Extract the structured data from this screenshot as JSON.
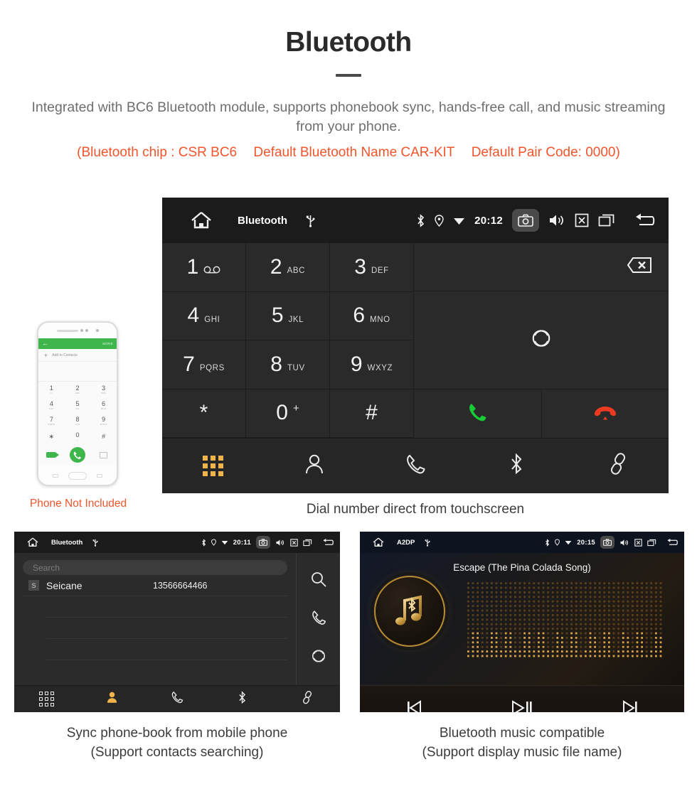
{
  "header": {
    "title": "Bluetooth",
    "description": "Integrated with BC6 Bluetooth module, supports phonebook sync, hands-free call, and music streaming from your phone.",
    "spec_chip": "(Bluetooth chip : CSR BC6",
    "spec_name": "Default Bluetooth Name CAR-KIT",
    "spec_code": "Default Pair Code: 0000)",
    "accent_color": "#f2552c",
    "text_color": "#6f6f6f"
  },
  "main_unit": {
    "statusbar": {
      "home_icon": "home-icon",
      "title": "Bluetooth",
      "usb_icon": "usb-icon",
      "bluetooth_icon": "bluetooth-icon",
      "location_icon": "location-pin-icon",
      "wifi_icon": "wifi-icon",
      "clock": "20:12",
      "camera_icon": "camera-icon",
      "volume_icon": "volume-icon",
      "close_icon": "close-box-icon",
      "recents_icon": "recents-icon",
      "back_icon": "back-arrow-icon"
    },
    "keys": [
      {
        "digit": "1",
        "letters": "",
        "voicemail": true
      },
      {
        "digit": "2",
        "letters": "ABC"
      },
      {
        "digit": "3",
        "letters": "DEF"
      },
      {
        "digit": "4",
        "letters": "GHI"
      },
      {
        "digit": "5",
        "letters": "JKL"
      },
      {
        "digit": "6",
        "letters": "MNO"
      },
      {
        "digit": "7",
        "letters": "PQRS"
      },
      {
        "digit": "8",
        "letters": "TUV"
      },
      {
        "digit": "9",
        "letters": "WXYZ"
      },
      {
        "digit": "*",
        "letters": ""
      },
      {
        "digit": "0",
        "letters": "",
        "plus": "+"
      },
      {
        "digit": "#",
        "letters": ""
      }
    ],
    "actions": {
      "backspace_icon": "backspace-icon",
      "sync_icon": "sync-icon",
      "call_icon": "call-icon",
      "hangup_icon": "hangup-icon",
      "call_color": "#18cc35",
      "hangup_color": "#ee3a21"
    },
    "bottom_nav": [
      {
        "name": "dialpad",
        "icon": "dialpad-icon",
        "active": true
      },
      {
        "name": "contacts",
        "icon": "contacts-icon",
        "active": false
      },
      {
        "name": "call-history",
        "icon": "phone-handset-icon",
        "active": false
      },
      {
        "name": "bluetooth",
        "icon": "bluetooth-icon",
        "active": false
      },
      {
        "name": "pair",
        "icon": "link-icon",
        "active": false
      }
    ],
    "active_color": "#f0b44a",
    "caption": "Dial number direct from touchscreen"
  },
  "phone_mock": {
    "appbar_back": "←",
    "appbar_more": "MORE",
    "add_to_contacts": "Add to Contacts",
    "keys": [
      {
        "d": "1",
        "l": "oo"
      },
      {
        "d": "2",
        "l": "ABC"
      },
      {
        "d": "3",
        "l": "DEF"
      },
      {
        "d": "4",
        "l": "GHI"
      },
      {
        "d": "5",
        "l": "JKL"
      },
      {
        "d": "6",
        "l": "MNO"
      },
      {
        "d": "7",
        "l": "PQRS"
      },
      {
        "d": "8",
        "l": "TUV"
      },
      {
        "d": "9",
        "l": "WXYZ"
      },
      {
        "d": "∗",
        "l": ""
      },
      {
        "d": "0",
        "l": "+"
      },
      {
        "d": "#",
        "l": ""
      }
    ],
    "note": "Phone Not Included",
    "note_color": "#f2552c"
  },
  "phonebook_unit": {
    "statusbar": {
      "title": "Bluetooth",
      "clock": "20:11"
    },
    "search_placeholder": "Search",
    "contacts": [
      {
        "initial": "S",
        "name": "Seicane",
        "number": "13566664466"
      }
    ],
    "side_actions": [
      {
        "name": "search",
        "icon": "search-icon"
      },
      {
        "name": "call",
        "icon": "phone-handset-icon"
      },
      {
        "name": "sync",
        "icon": "sync-icon"
      }
    ],
    "bottom_nav": [
      {
        "name": "dialpad",
        "icon": "dialpad-icon",
        "active": false
      },
      {
        "name": "contacts",
        "icon": "contacts-icon",
        "active": true
      },
      {
        "name": "call-history",
        "icon": "phone-handset-icon",
        "active": false
      },
      {
        "name": "bluetooth",
        "icon": "bluetooth-icon",
        "active": false
      },
      {
        "name": "pair",
        "icon": "link-icon",
        "active": false
      }
    ],
    "caption_line1": "Sync phone-book from mobile phone",
    "caption_line2": "(Support contacts searching)"
  },
  "music_unit": {
    "statusbar": {
      "title": "A2DP",
      "clock": "20:15"
    },
    "track_name": "Escape (The Pina Colada Song)",
    "album_icon": "music-note-bluetooth-icon",
    "controls": [
      {
        "name": "previous",
        "icon": "previous-track-icon"
      },
      {
        "name": "play-pause",
        "icon": "play-pause-icon"
      },
      {
        "name": "next",
        "icon": "next-track-icon"
      }
    ],
    "gold_color": "#c79a3e",
    "caption_line1": "Bluetooth music compatible",
    "caption_line2": "(Support display music file name)"
  }
}
